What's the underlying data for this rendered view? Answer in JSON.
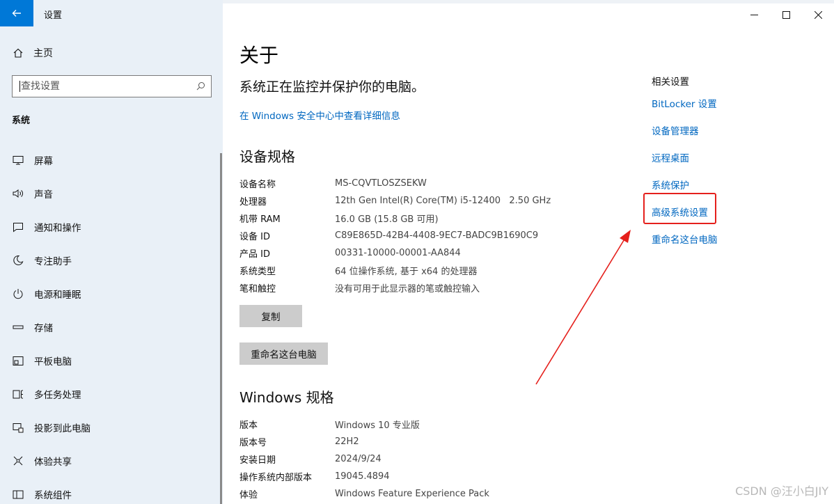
{
  "app": {
    "title": "设置"
  },
  "sidebar": {
    "home_label": "主页",
    "search_placeholder": "查找设置",
    "section_label": "系统",
    "items": [
      {
        "label": "屏幕",
        "icon": "monitor-icon"
      },
      {
        "label": "声音",
        "icon": "speaker-icon"
      },
      {
        "label": "通知和操作",
        "icon": "notification-icon"
      },
      {
        "label": "专注助手",
        "icon": "moon-icon"
      },
      {
        "label": "电源和睡眠",
        "icon": "power-icon"
      },
      {
        "label": "存储",
        "icon": "storage-icon"
      },
      {
        "label": "平板电脑",
        "icon": "tablet-icon"
      },
      {
        "label": "多任务处理",
        "icon": "multitask-icon"
      },
      {
        "label": "投影到此电脑",
        "icon": "project-icon"
      },
      {
        "label": "体验共享",
        "icon": "share-icon"
      },
      {
        "label": "系统组件",
        "icon": "components-icon"
      }
    ]
  },
  "main": {
    "title": "关于",
    "status": "系统正在监控并保护你的电脑。",
    "security_link": "在 Windows 安全中心中查看详细信息",
    "device_specs": {
      "heading": "设备规格",
      "rows": [
        {
          "k": "设备名称",
          "v": "MS-CQVTLOSZSEKW"
        },
        {
          "k": "处理器",
          "v": "12th Gen Intel(R) Core(TM) i5-12400   2.50 GHz"
        },
        {
          "k": "机带 RAM",
          "v": "16.0 GB (15.8 GB 可用)"
        },
        {
          "k": "设备 ID",
          "v": "C89E865D-42B4-4408-9EC7-BADC9B1690C9"
        },
        {
          "k": "产品 ID",
          "v": "00331-10000-00001-AA844"
        },
        {
          "k": "系统类型",
          "v": "64 位操作系统, 基于 x64 的处理器"
        },
        {
          "k": "笔和触控",
          "v": "没有可用于此显示器的笔或触控输入"
        }
      ],
      "copy_button": "复制",
      "rename_button": "重命名这台电脑"
    },
    "windows_specs": {
      "heading": "Windows 规格",
      "rows": [
        {
          "k": "版本",
          "v": "Windows 10 专业版"
        },
        {
          "k": "版本号",
          "v": "22H2"
        },
        {
          "k": "安装日期",
          "v": "2024/9/24"
        },
        {
          "k": "操作系统内部版本",
          "v": "19045.4894"
        },
        {
          "k": "体验",
          "v": "Windows Feature Experience Pack"
        }
      ]
    }
  },
  "related": {
    "title": "相关设置",
    "links": [
      "BitLocker 设置",
      "设备管理器",
      "远程桌面",
      "系统保护",
      "高级系统设置",
      "重命名这台电脑"
    ]
  },
  "annotation_color": "#e5201c",
  "accent_color": "#0078d7",
  "watermark": "CSDN @汪小白JIY"
}
